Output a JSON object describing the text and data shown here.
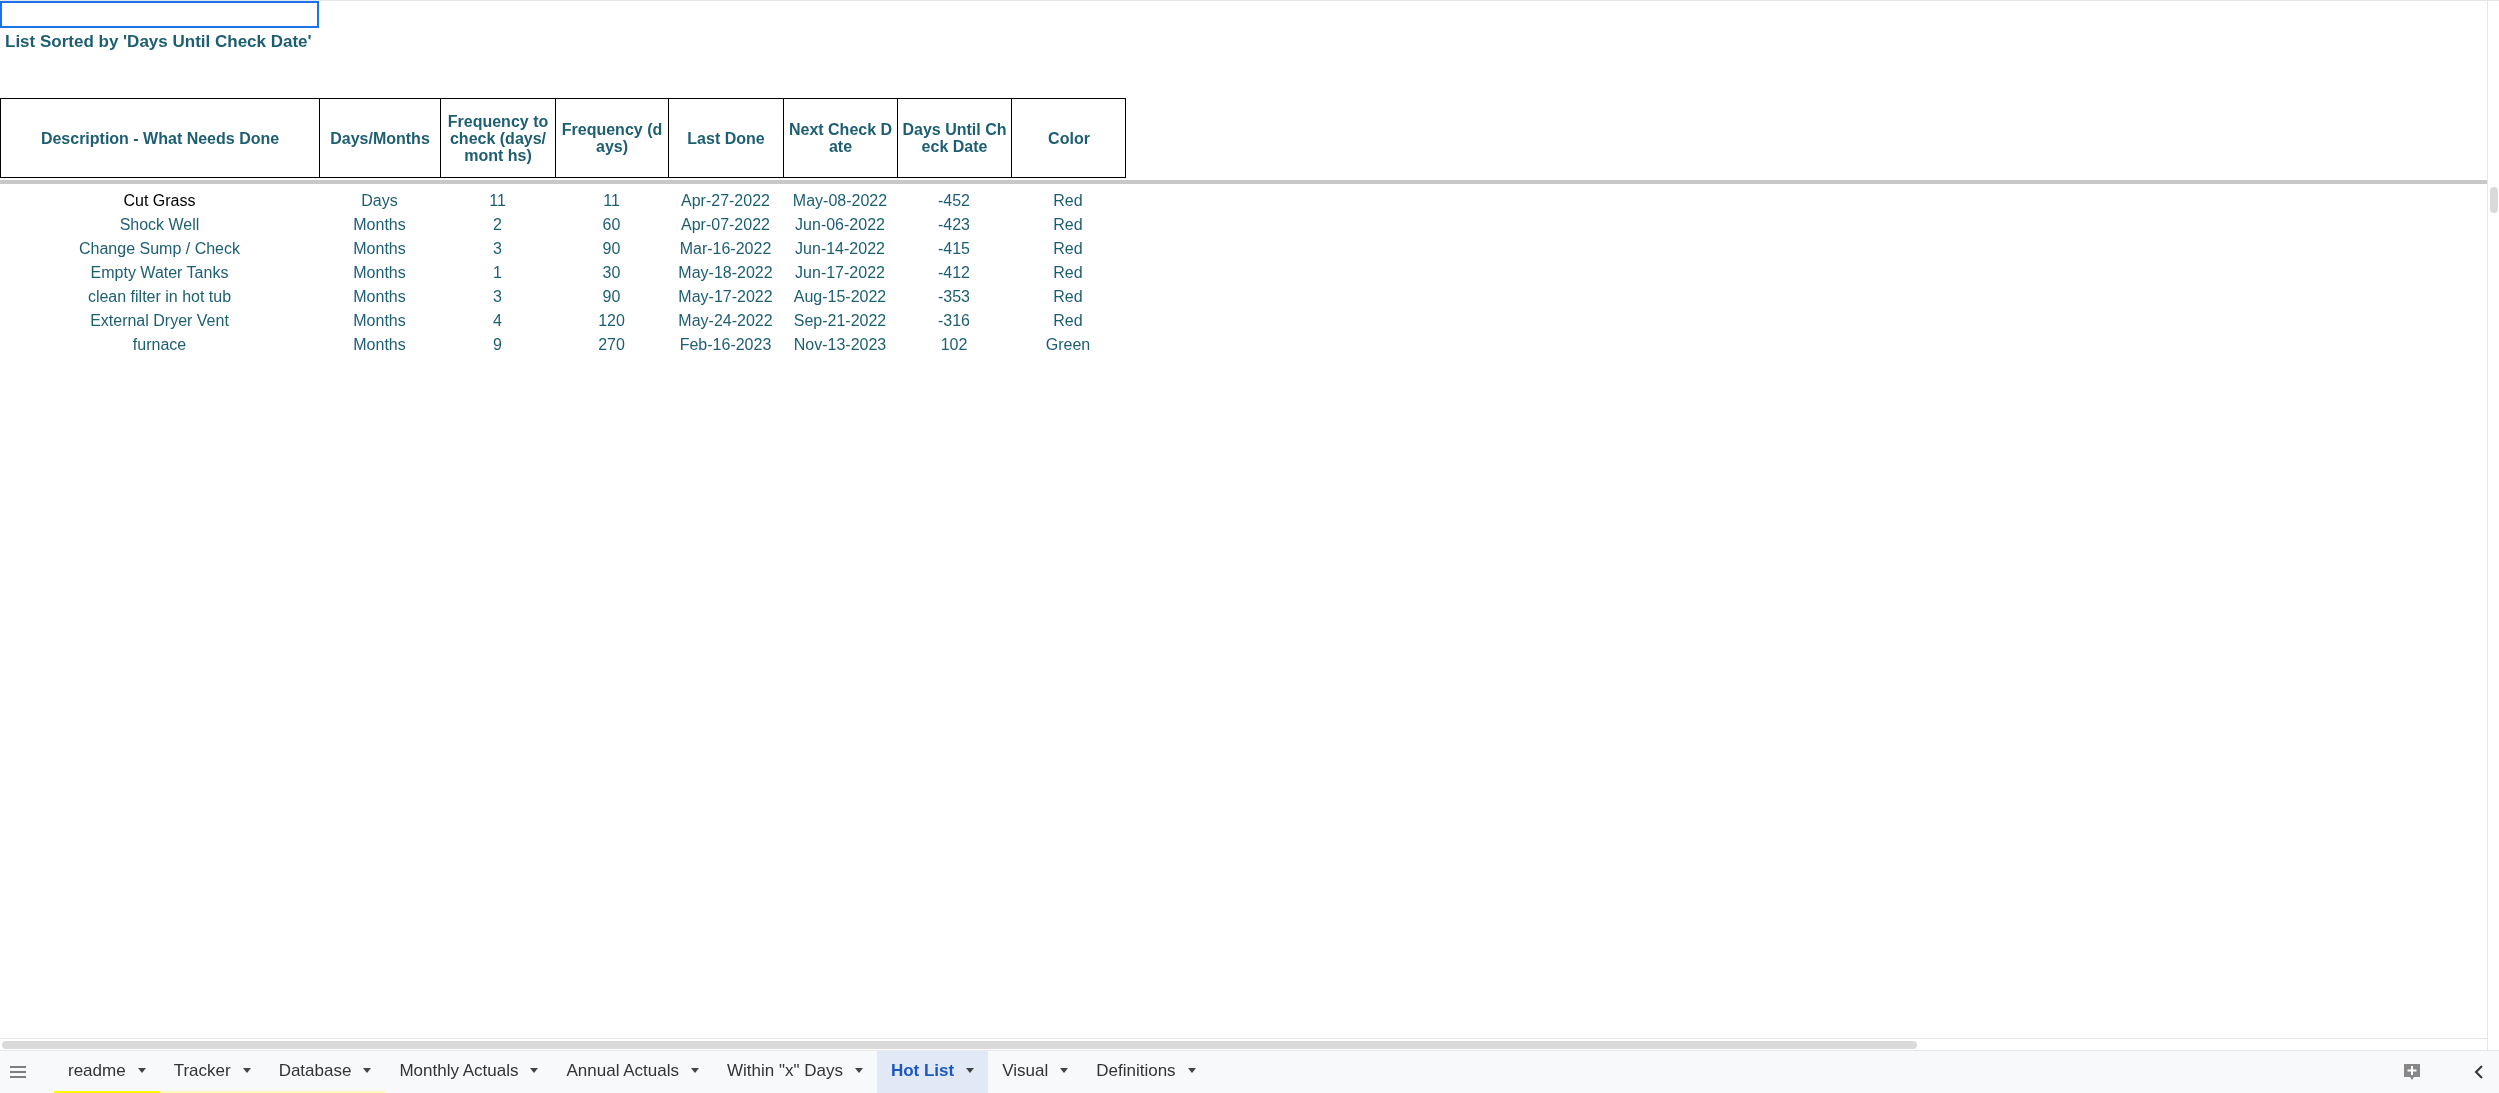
{
  "sheet": {
    "title": "List Sorted by 'Days Until Check Date'",
    "columns": [
      "Description - What Needs Done",
      "Days/Months",
      "Frequency to check (days/mont hs)",
      "Frequency (days)",
      "Last Done",
      "Next Check Date",
      "Days Until Check Date",
      "Color"
    ],
    "rows": [
      [
        "Cut Grass",
        "Days",
        "11",
        "11",
        "Apr-27-2022",
        "May-08-2022",
        "-452",
        "Red"
      ],
      [
        "Shock Well",
        "Months",
        "2",
        "60",
        "Apr-07-2022",
        "Jun-06-2022",
        "-423",
        "Red"
      ],
      [
        "Change Sump / Check",
        "Months",
        "3",
        "90",
        "Mar-16-2022",
        "Jun-14-2022",
        "-415",
        "Red"
      ],
      [
        "Empty Water Tanks",
        "Months",
        "1",
        "30",
        "May-18-2022",
        "Jun-17-2022",
        "-412",
        "Red"
      ],
      [
        "clean filter in hot tub",
        "Months",
        "3",
        "90",
        "May-17-2022",
        "Aug-15-2022",
        "-353",
        "Red"
      ],
      [
        "External Dryer Vent",
        "Months",
        "4",
        "120",
        "May-24-2022",
        "Sep-21-2022",
        "-316",
        "Red"
      ],
      [
        "furnace",
        "Months",
        "9",
        "270",
        "Feb-16-2023",
        "Nov-13-2023",
        "102",
        "Green"
      ]
    ]
  },
  "tabs": [
    {
      "label": "readme",
      "selected": false,
      "color": "#ffff00"
    },
    {
      "label": "Tracker",
      "selected": false,
      "color": "#fff9c4"
    },
    {
      "label": "Database",
      "selected": false,
      "color": "#fff9c4"
    },
    {
      "label": "Monthly Actuals",
      "selected": false
    },
    {
      "label": "Annual Actuals",
      "selected": false
    },
    {
      "label": "Within \"x\" Days",
      "selected": false
    },
    {
      "label": "Hot List",
      "selected": true
    },
    {
      "label": "Visual",
      "selected": false
    },
    {
      "label": "Definitions",
      "selected": false
    }
  ]
}
